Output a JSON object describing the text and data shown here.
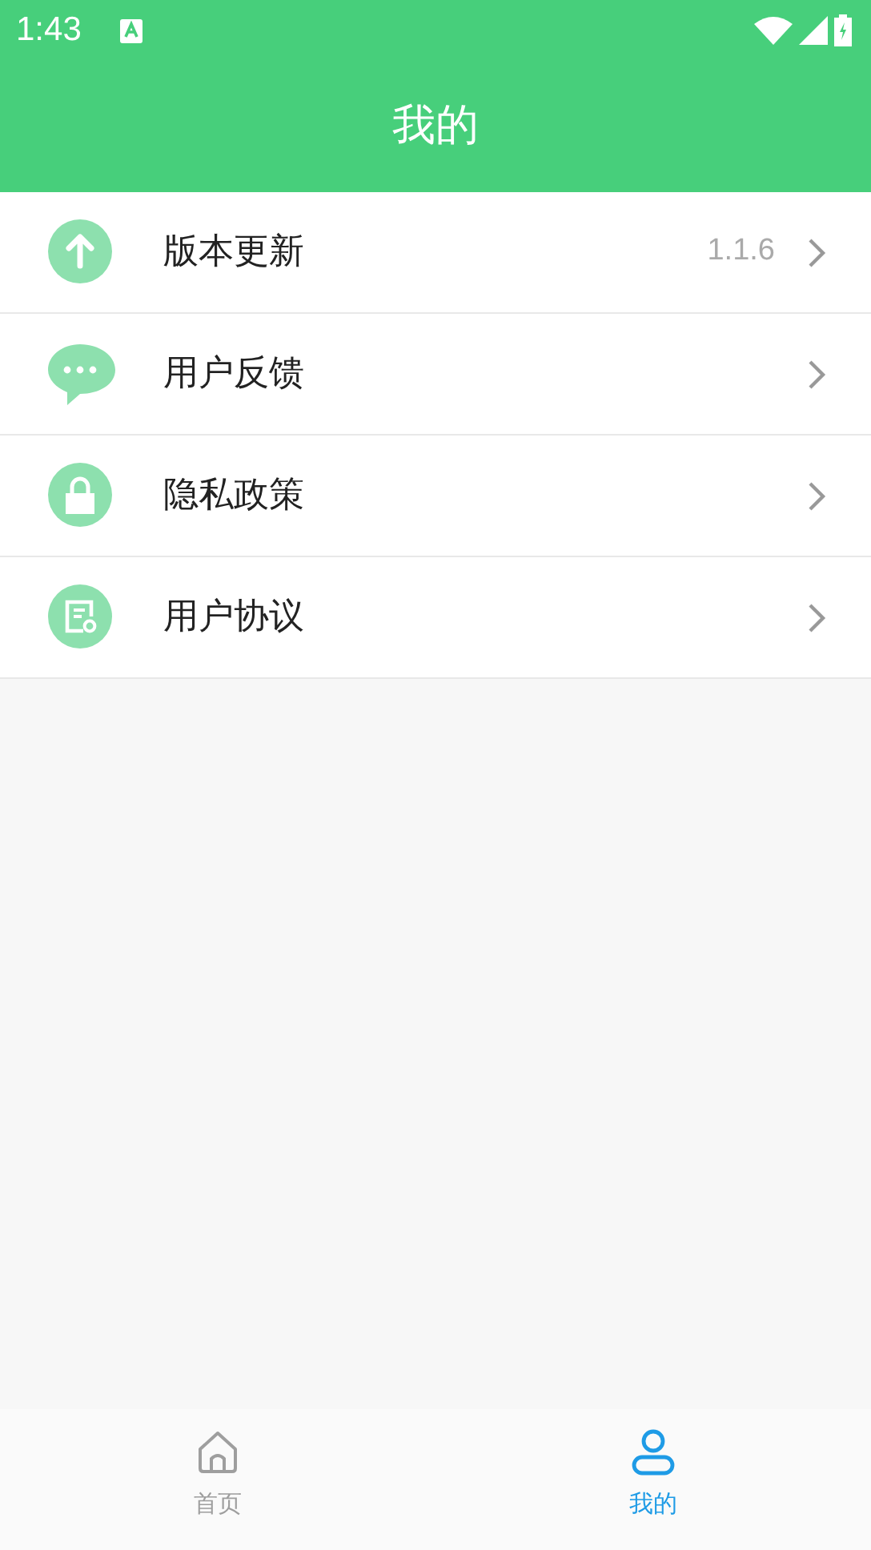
{
  "status_bar": {
    "time": "1:43"
  },
  "header": {
    "title": "我的"
  },
  "menu": [
    {
      "label": "版本更新",
      "value": "1.1.6"
    },
    {
      "label": "用户反馈"
    },
    {
      "label": "隐私政策"
    },
    {
      "label": "用户协议"
    }
  ],
  "bottom_nav": [
    {
      "label": "首页",
      "selected": false
    },
    {
      "label": "我的",
      "selected": true
    }
  ]
}
